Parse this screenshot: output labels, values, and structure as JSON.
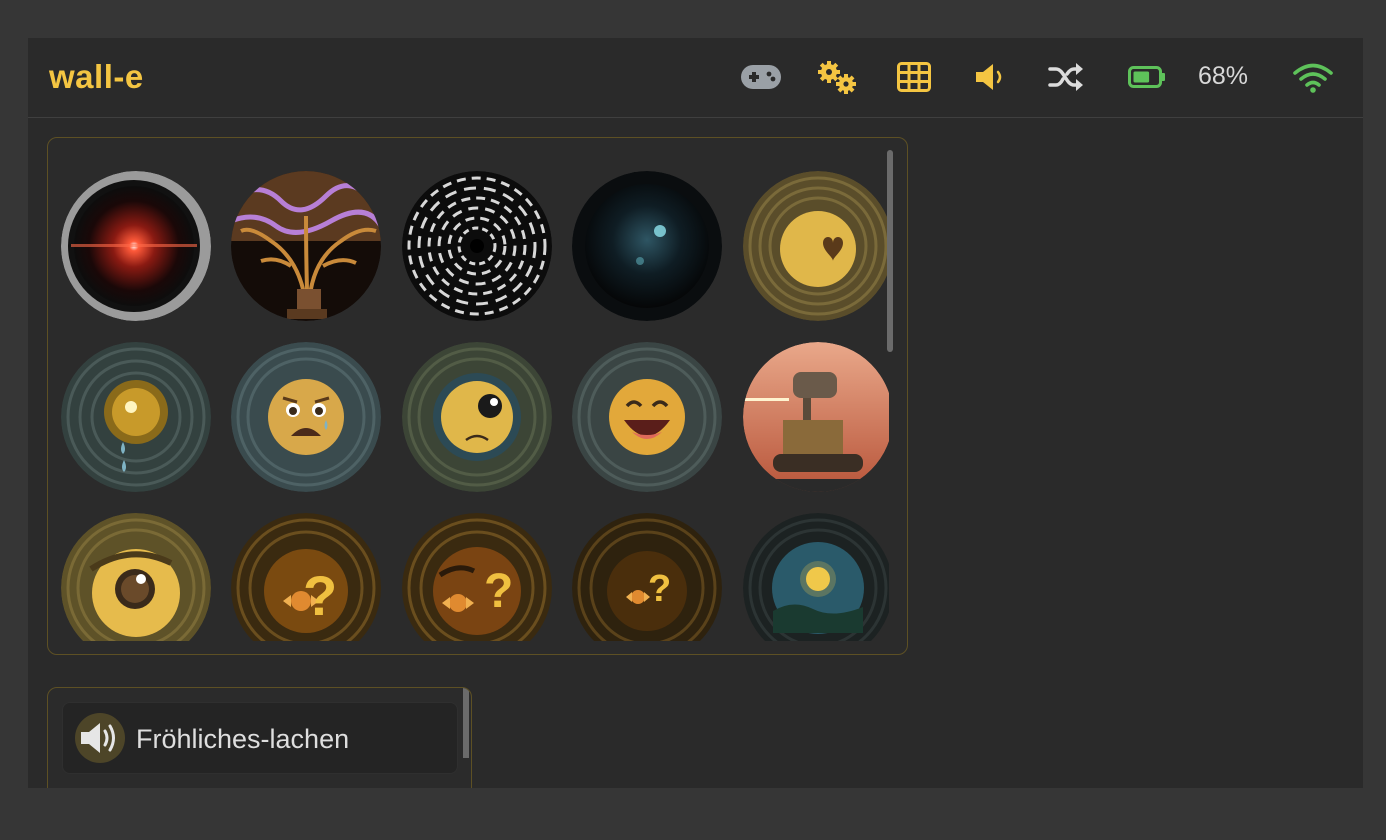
{
  "app": {
    "title": "wall-e"
  },
  "status": {
    "battery_percent_text": "68%",
    "battery_level": 0.68,
    "icons": [
      "gamepad-icon",
      "gears-icon",
      "grid-icon",
      "volume-low-icon",
      "shuffle-icon",
      "battery-icon",
      "wifi-icon"
    ]
  },
  "colors": {
    "accent": "#f4c542",
    "battery_green": "#5ec25a",
    "wifi_green": "#5ec25a",
    "gamepad_gray": "#9aa0a6",
    "border_gold": "#5d5024"
  },
  "faces": [
    "red-lens-eye",
    "tree-boot-art",
    "white-swirl-vortex",
    "dark-blue-orb",
    "heart-eye",
    "crying-golden-eye",
    "scared-crying-face",
    "sad-one-eye",
    "laughing-face",
    "wall-e-robot-photo",
    "looking-eye",
    "candy-question",
    "candy-question-eyebrow",
    "candy-question-dim",
    "night-sky-sun"
  ],
  "sounds": [
    {
      "label": "Fröhliches-lachen",
      "icon": "speaker-icon"
    }
  ]
}
